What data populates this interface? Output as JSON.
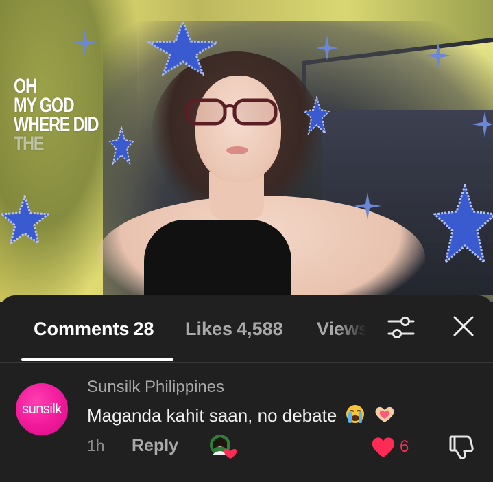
{
  "video": {
    "overlay_lines": [
      "OH",
      "MY GOD",
      "WHERE DID",
      "THE"
    ],
    "sticker_color": "#3a5bd0"
  },
  "tabs": {
    "comments_label": "Comments",
    "comments_count": "28",
    "likes_label": "Likes",
    "likes_count": "4,588",
    "views_label": "Views"
  },
  "comment": {
    "avatar_text": "sunsilk",
    "author": "Sunsilk Philippines",
    "text": "Maganda kahit saan, no debate",
    "emojis": [
      "loudly-crying-face-emoji",
      "heart-hands-emoji"
    ],
    "time": "1h",
    "reply_label": "Reply",
    "like_count": "6",
    "liked_by_creator": true
  },
  "colors": {
    "sheet_bg": "#202020",
    "active_tab": "#ffffff",
    "inactive_tab": "#a9a9a9",
    "like_red": "#fe2c55",
    "brand_pink": "#f0189a"
  }
}
